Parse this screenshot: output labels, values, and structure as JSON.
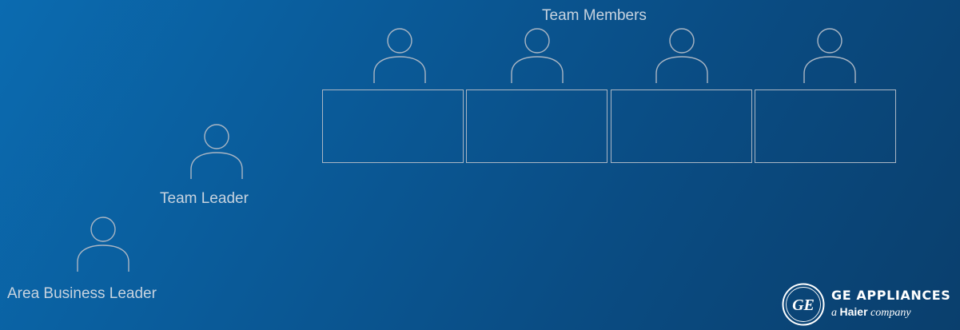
{
  "diagram": {
    "team_members": {
      "label": "Team Members",
      "icons": [
        "person-icon",
        "person-icon",
        "person-icon",
        "person-icon"
      ]
    },
    "team_leader": {
      "label": "Team Leader",
      "icon": "person-icon"
    },
    "area_business_leader": {
      "label": "Area Business Leader",
      "icon": "person-icon"
    }
  },
  "brand": {
    "monogram_text": "GE",
    "name": "GE APPLIANCES",
    "tagline_a": "a",
    "tagline_haier": "Haier",
    "tagline_company": "company"
  },
  "colors": {
    "background_start": "#0b6bb0",
    "background_end": "#0a3f6d",
    "outline": "#aab6c4",
    "label_text": "#c7d3df",
    "logo": "#ffffff"
  }
}
